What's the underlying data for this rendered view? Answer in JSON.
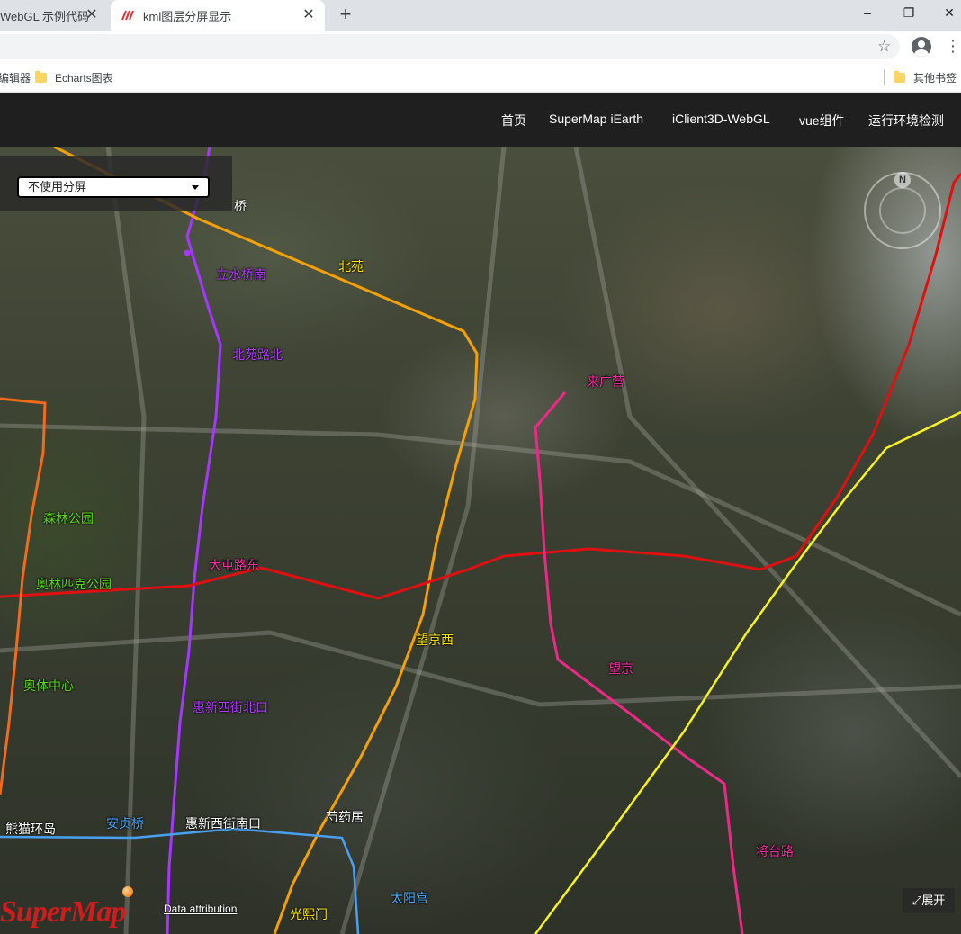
{
  "browser": {
    "tabs": [
      {
        "title": "WebGL 示例代码",
        "active": false
      },
      {
        "title": "kml图层分屏显示",
        "active": true
      }
    ],
    "new_tab_symbol": "+",
    "window_controls": {
      "minimize": "–",
      "maximize": "❐",
      "close": "✕"
    },
    "bookmarks": [
      {
        "label": "编辑器"
      },
      {
        "label": "Echarts图表",
        "icon": "folder-icon"
      },
      {
        "label": "其他书签",
        "icon": "folder-icon"
      }
    ]
  },
  "site_nav": {
    "links": [
      "首页",
      "SuperMap iEarth",
      "iClient3D-WebGL",
      "vue组件",
      "运行环境检测"
    ]
  },
  "split_select": {
    "value": "不使用分屏"
  },
  "map": {
    "compass_label": "N",
    "labels": [
      {
        "text": "桥",
        "color": "#ffffff"
      },
      {
        "text": "北苑",
        "color": "#ffe800"
      },
      {
        "text": "立水桥南",
        "color": "#b03cff"
      },
      {
        "text": "北苑路北",
        "color": "#b03cff"
      },
      {
        "text": "来广营",
        "color": "#ff2aa0"
      },
      {
        "text": "森林公园",
        "color": "#5bd81a"
      },
      {
        "text": "奥林匹克公园",
        "color": "#5bd81a"
      },
      {
        "text": "大屯路东",
        "color": "#ff2aa0"
      },
      {
        "text": "望京西",
        "color": "#ffe800"
      },
      {
        "text": "望京",
        "color": "#ff2aa0"
      },
      {
        "text": "奥体中心",
        "color": "#5bd81a"
      },
      {
        "text": "惠新西街北口",
        "color": "#b03cff"
      },
      {
        "text": "熊猫环岛",
        "color": "#ffffff"
      },
      {
        "text": "安贞桥",
        "color": "#4aa8ff"
      },
      {
        "text": "惠新西街南口",
        "color": "#ffffff"
      },
      {
        "text": "芍药居",
        "color": "#ffffff"
      },
      {
        "text": "将台路",
        "color": "#ff2aa0"
      },
      {
        "text": "太阳宫",
        "color": "#4aa8ff"
      },
      {
        "text": "光熙门",
        "color": "#ffe800"
      }
    ],
    "expand_label": "展开",
    "logo_text": "SuperMap",
    "attribution": "Data attribution"
  }
}
